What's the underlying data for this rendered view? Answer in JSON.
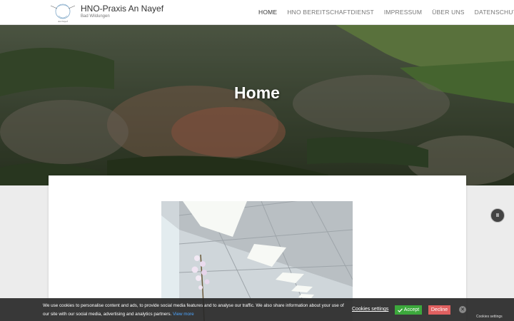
{
  "header": {
    "brand_title": "HNO-Praxis An Nayef",
    "brand_subtitle": "Bad Wildungen",
    "logo_text": "An Nayef",
    "nav": [
      {
        "label": "HOME"
      },
      {
        "label": "HNO BEREITSCHAFTDIENST"
      },
      {
        "label": "IMPRESSUM"
      },
      {
        "label": "ÜBER UNS"
      },
      {
        "label": "DATENSCHUTZ"
      }
    ]
  },
  "hero": {
    "title": "Home"
  },
  "slider": {
    "pause_icon": "pause-icon",
    "pause_glyph": "II"
  },
  "cookie": {
    "text": "We use cookies to personalise content and ads, to provide social media features and to analyse our traffic. We also share information about your use of our site with our social media, advertising and analytics partners.",
    "view_more": "View more",
    "settings_label": "Cookies settings",
    "accept_label": "Accept",
    "decline_label": "Decline",
    "close_glyph": "✕",
    "tab_label": "Cookies settings"
  },
  "colors": {
    "accept": "#3ca83c",
    "decline": "#e06060",
    "link": "#4ea6ff"
  }
}
